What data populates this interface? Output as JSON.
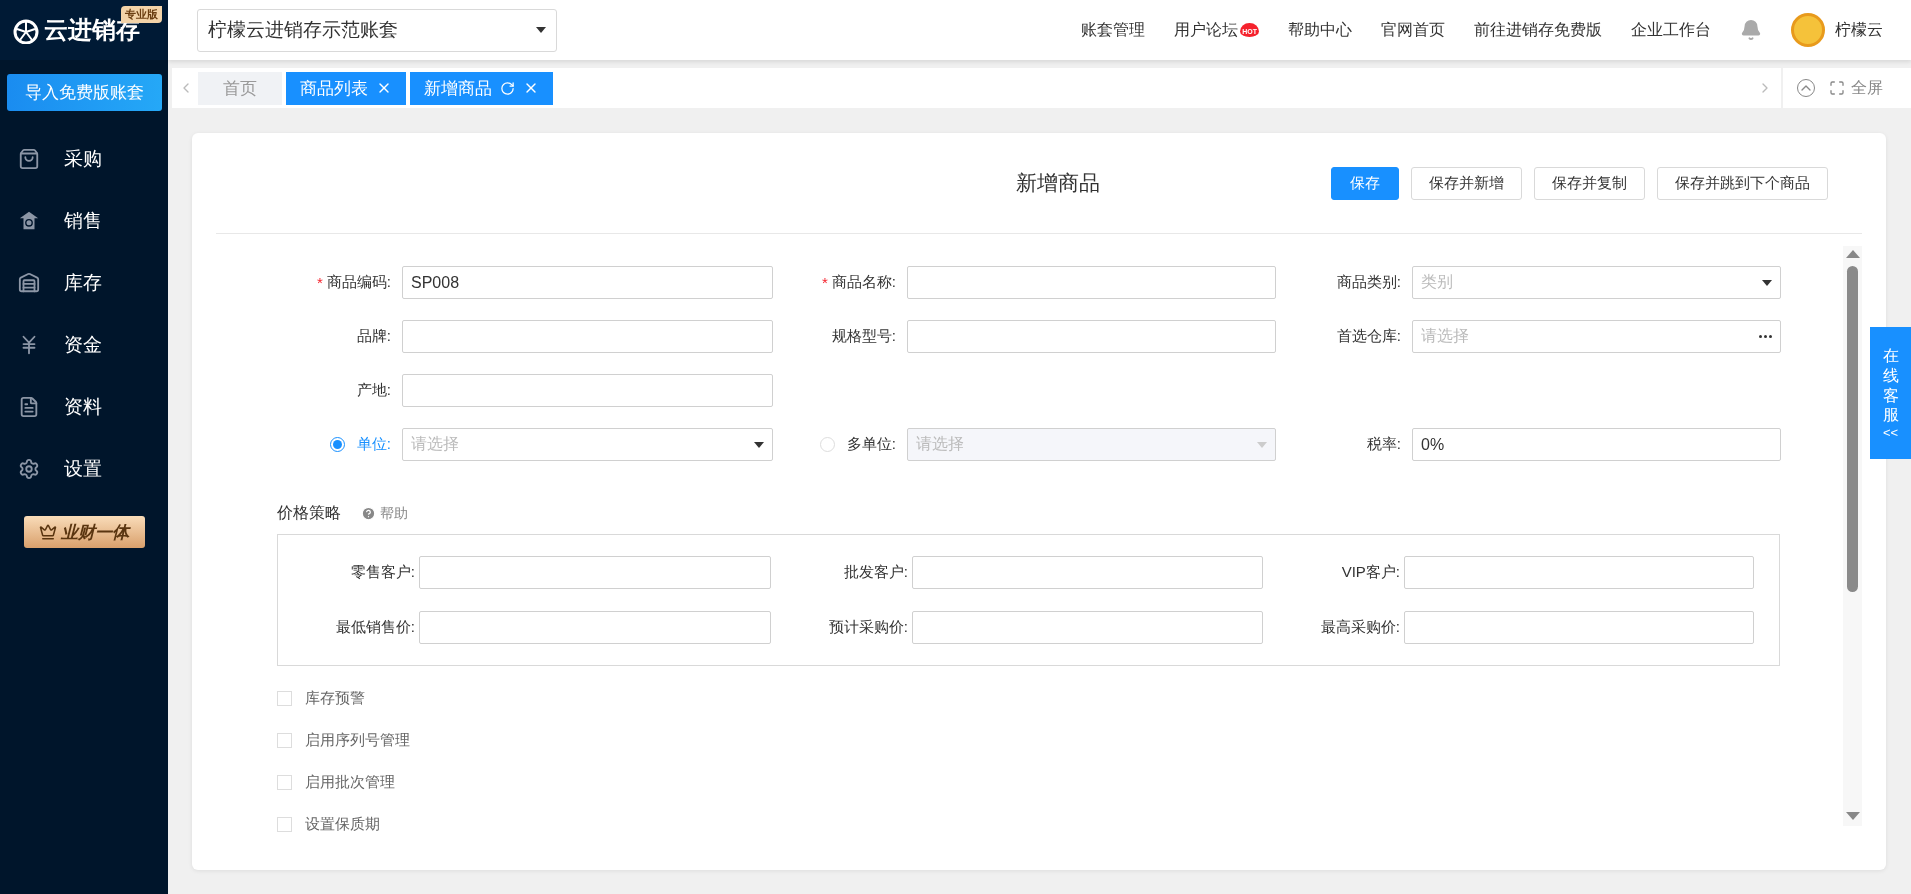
{
  "logo": {
    "name": "云进销存",
    "edition": "专业版"
  },
  "account_select": {
    "value": "柠檬云进销存示范账套"
  },
  "nav": [
    {
      "label": "账套管理",
      "hot": false
    },
    {
      "label": "用户论坛",
      "hot": true,
      "hot_label": "HOT"
    },
    {
      "label": "帮助中心",
      "hot": false
    },
    {
      "label": "官网首页",
      "hot": false
    },
    {
      "label": "前往进销存免费版",
      "hot": false
    },
    {
      "label": "企业工作台",
      "hot": false
    }
  ],
  "user": {
    "name": "柠檬云"
  },
  "sidebar": {
    "import_button": "导入免费版账套",
    "menu": [
      {
        "label": "采购"
      },
      {
        "label": "销售"
      },
      {
        "label": "库存"
      },
      {
        "label": "资金"
      },
      {
        "label": "资料"
      },
      {
        "label": "设置"
      }
    ],
    "badge": "业财一体"
  },
  "tabs": [
    {
      "label": "首页",
      "selected": false,
      "closable": false,
      "refresh": false
    },
    {
      "label": "商品列表",
      "selected": true,
      "closable": true,
      "refresh": false
    },
    {
      "label": "新增商品",
      "selected": true,
      "closable": true,
      "refresh": true
    }
  ],
  "tab_tools": {
    "fullscreen": "全屏"
  },
  "form": {
    "title": "新增商品",
    "required_mark": "*",
    "actions": [
      {
        "label": "保存",
        "primary": true
      },
      {
        "label": "保存并新增",
        "primary": false
      },
      {
        "label": "保存并复制",
        "primary": false
      },
      {
        "label": "保存并跳到下个商品",
        "primary": false
      }
    ],
    "rows": [
      [
        {
          "kind": "text",
          "label": "商品编码:",
          "required": true,
          "value": "SP008"
        },
        {
          "kind": "text",
          "label": "商品名称:",
          "required": true
        },
        {
          "kind": "select",
          "label": "商品类别:",
          "required": false,
          "placeholder": "类别"
        }
      ],
      [
        {
          "kind": "text",
          "label": "品牌:",
          "required": false
        },
        {
          "kind": "text",
          "label": "规格型号:",
          "required": false
        },
        {
          "kind": "more",
          "label": "首选仓库:",
          "required": false,
          "placeholder": "请选择"
        }
      ],
      [
        {
          "kind": "text",
          "label": "产地:",
          "required": false
        }
      ],
      [
        {
          "kind": "radio",
          "label": "单位:",
          "selected": true,
          "disabled": false,
          "placeholder": "请选择"
        },
        {
          "kind": "radio",
          "label": "多单位:",
          "selected": false,
          "disabled": true,
          "placeholder": "请选择"
        },
        {
          "kind": "text",
          "label": "税率:",
          "required": false,
          "value": "0%"
        }
      ]
    ],
    "price_strategy": {
      "title": "价格策略",
      "help": "帮助",
      "fields": [
        {
          "label": "零售客户:"
        },
        {
          "label": "批发客户:"
        },
        {
          "label": "VIP客户:"
        },
        {
          "label": "最低销售价:"
        },
        {
          "label": "预计采购价:"
        },
        {
          "label": "最高采购价:"
        }
      ]
    },
    "options": [
      {
        "label": "库存预警",
        "checked": false
      },
      {
        "label": "启用序列号管理",
        "checked": false
      },
      {
        "label": "启用批次管理",
        "checked": false
      },
      {
        "label": "设置保质期",
        "checked": false
      }
    ]
  },
  "service": {
    "label": "在线客服",
    "arrow": "<<"
  }
}
